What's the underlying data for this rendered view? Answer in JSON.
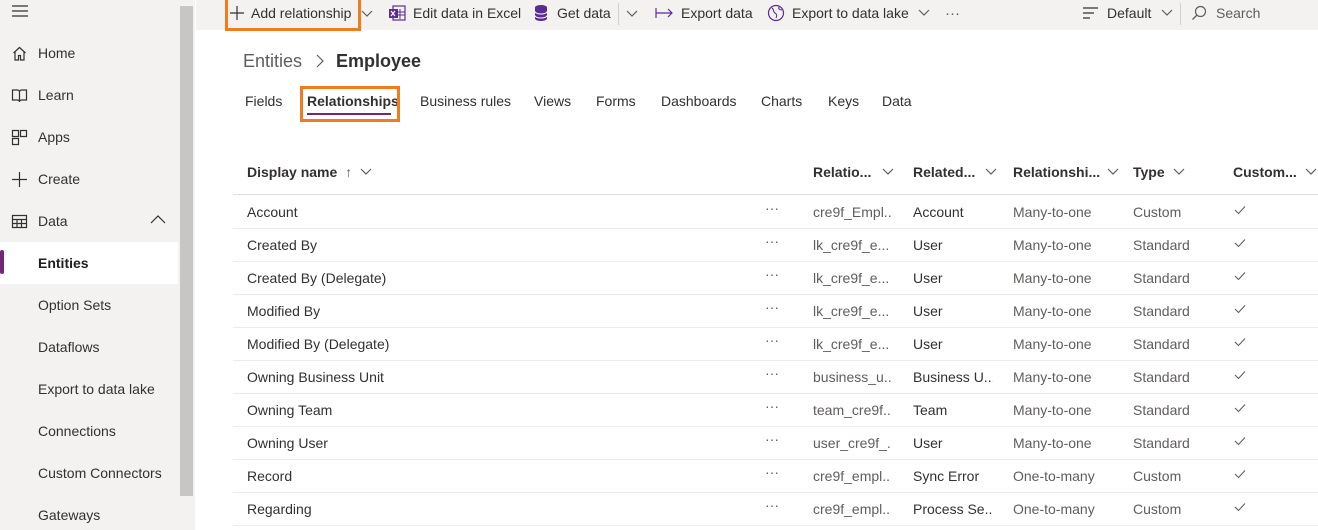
{
  "sidebar": {
    "items": [
      {
        "label": "Home",
        "icon": "home-icon"
      },
      {
        "label": "Learn",
        "icon": "book-icon"
      },
      {
        "label": "Apps",
        "icon": "apps-icon"
      },
      {
        "label": "Create",
        "icon": "plus-icon"
      },
      {
        "label": "Data",
        "icon": "table-icon"
      },
      {
        "label": "Entities"
      },
      {
        "label": "Option Sets"
      },
      {
        "label": "Dataflows"
      },
      {
        "label": "Export to data lake"
      },
      {
        "label": "Connections"
      },
      {
        "label": "Custom Connectors"
      },
      {
        "label": "Gateways"
      }
    ]
  },
  "commandbar": {
    "add_relationship": "Add relationship",
    "edit_excel": "Edit data in Excel",
    "get_data": "Get data",
    "export_data": "Export data",
    "export_lake": "Export to data lake",
    "more": "···",
    "view": "Default",
    "search_placeholder": "Search"
  },
  "breadcrumb": {
    "parent": "Entities",
    "current": "Employee"
  },
  "tabs": [
    "Fields",
    "Relationships",
    "Business rules",
    "Views",
    "Forms",
    "Dashboards",
    "Charts",
    "Keys",
    "Data"
  ],
  "table": {
    "columns": [
      "Display name",
      "Relatio...",
      "Related...",
      "Relationshi...",
      "Type",
      "Custom..."
    ],
    "sort_indicator": "↑",
    "more_label": "···",
    "check_mark": "✓",
    "rows": [
      {
        "name": "Account",
        "relationship": "cre9f_Empl...",
        "related": "Account",
        "reltype": "Many-to-one",
        "type": "Custom"
      },
      {
        "name": "Created By",
        "relationship": "lk_cre9f_e...",
        "related": "User",
        "reltype": "Many-to-one",
        "type": "Standard"
      },
      {
        "name": "Created By (Delegate)",
        "relationship": "lk_cre9f_e...",
        "related": "User",
        "reltype": "Many-to-one",
        "type": "Standard"
      },
      {
        "name": "Modified By",
        "relationship": "lk_cre9f_e...",
        "related": "User",
        "reltype": "Many-to-one",
        "type": "Standard"
      },
      {
        "name": "Modified By (Delegate)",
        "relationship": "lk_cre9f_e...",
        "related": "User",
        "reltype": "Many-to-one",
        "type": "Standard"
      },
      {
        "name": "Owning Business Unit",
        "relationship": "business_u...",
        "related": "Business U...",
        "reltype": "Many-to-one",
        "type": "Standard"
      },
      {
        "name": "Owning Team",
        "relationship": "team_cre9f...",
        "related": "Team",
        "reltype": "Many-to-one",
        "type": "Standard"
      },
      {
        "name": "Owning User",
        "relationship": "user_cre9f_...",
        "related": "User",
        "reltype": "Many-to-one",
        "type": "Standard"
      },
      {
        "name": "Record",
        "relationship": "cre9f_empl...",
        "related": "Sync Error",
        "reltype": "One-to-many",
        "type": "Custom"
      },
      {
        "name": "Regarding",
        "relationship": "cre9f_empl...",
        "related": "Process Se...",
        "reltype": "One-to-many",
        "type": "Custom"
      }
    ]
  },
  "colors": {
    "accent": "#742774",
    "highlight": "#f07c20"
  }
}
